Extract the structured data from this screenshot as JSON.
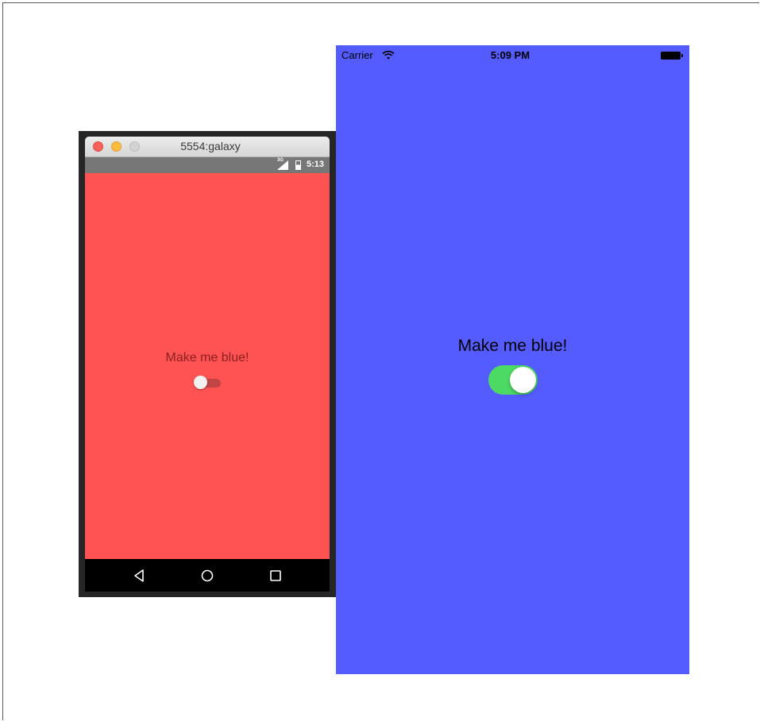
{
  "android": {
    "window_title": "5554:galaxy",
    "status": {
      "network_label": "3G",
      "time": "5:13"
    },
    "label": "Make me blue!",
    "switch_on": false,
    "colors": {
      "background": "#ff5353",
      "label": "#8a1f1f",
      "track": "#c24545"
    },
    "nav": {
      "back_icon": "back-triangle-icon",
      "home_icon": "home-circle-icon",
      "recents_icon": "recents-square-icon"
    }
  },
  "ios": {
    "status": {
      "carrier": "Carrier",
      "time": "5:09 PM"
    },
    "label": "Make me blue!",
    "switch_on": true,
    "colors": {
      "background": "#545cff",
      "switch_on": "#4cd964"
    }
  }
}
